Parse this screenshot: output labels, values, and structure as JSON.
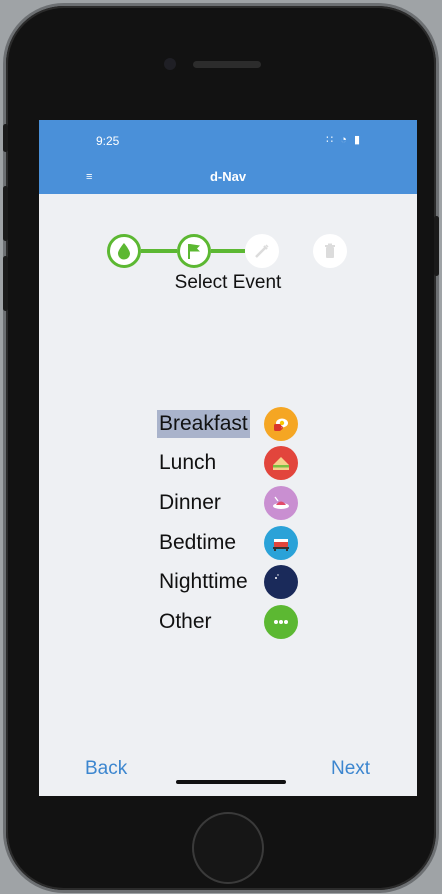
{
  "status_bar": {
    "time": "9:25",
    "icons": "∷ ◔ ▮"
  },
  "header": {
    "title": "d-Nav",
    "menu_icon": "≡"
  },
  "stepper": {
    "current_label": "Select Event",
    "steps": [
      {
        "icon": "drop-icon",
        "state": "done"
      },
      {
        "icon": "flag-icon",
        "state": "done"
      },
      {
        "icon": "syringe-icon",
        "state": "todo"
      },
      {
        "icon": "trash-icon",
        "state": "todo"
      }
    ],
    "accent_color": "#5cb832"
  },
  "events": [
    {
      "label": "Breakfast",
      "icon": "coffee-egg-icon",
      "color": "#f5a623",
      "selected": true
    },
    {
      "label": "Lunch",
      "icon": "sandwich-icon",
      "color": "#e2453c",
      "selected": false
    },
    {
      "label": "Dinner",
      "icon": "dinner-plate-icon",
      "color": "#c98fd1",
      "selected": false
    },
    {
      "label": "Bedtime",
      "icon": "bed-icon",
      "color": "#2aa2d8",
      "selected": false
    },
    {
      "label": "Nighttime",
      "icon": "moon-stars-icon",
      "color": "#1a2a5a",
      "selected": false
    },
    {
      "label": "Other",
      "icon": "more-dots-icon",
      "color": "#5cb832",
      "selected": false
    }
  ],
  "footer": {
    "back_label": "Back",
    "next_label": "Next"
  },
  "colors": {
    "header": "#4a90d9",
    "link": "#3c86cf",
    "selection": "#a9b3cb"
  }
}
